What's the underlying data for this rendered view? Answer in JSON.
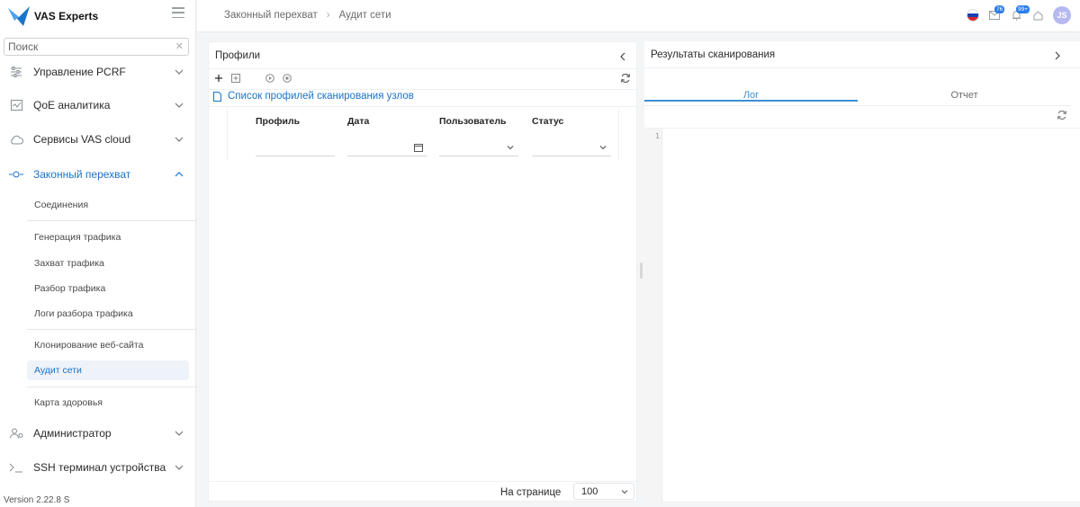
{
  "app": {
    "logo_text": "VAS Experts",
    "version": "Version 2.22.8 S"
  },
  "search": {
    "placeholder": "Поиск",
    "value": ""
  },
  "sidebar": {
    "items": [
      {
        "label": "Управление PCRF",
        "icon": "sliders-icon",
        "expanded": false
      },
      {
        "label": "QoE аналитика",
        "icon": "chart-icon",
        "expanded": false
      },
      {
        "label": "Сервисы VAS cloud",
        "icon": "cloud-icon",
        "expanded": false
      },
      {
        "label": "Законный перехват",
        "icon": "intercept-icon",
        "expanded": true,
        "active": true
      },
      {
        "label": "Администратор",
        "icon": "admin-icon",
        "expanded": false
      },
      {
        "label": "SSH терминал устройства",
        "icon": "terminal-icon",
        "expanded": false
      }
    ],
    "sub_items": [
      "Соединения",
      "Генерация трафика",
      "Захват трафика",
      "Разбор трафика",
      "Логи разбора трафика",
      "Клонирование веб-сайта",
      "Аудит сети",
      "Карта здоровья"
    ],
    "selected_sub_item": "Аудит сети"
  },
  "breadcrumb": {
    "parent": "Законный перехват",
    "current": "Аудит сети"
  },
  "header": {
    "mail_badge": "76",
    "notifications_badge": "99+",
    "avatar_initials": "JS"
  },
  "profiles": {
    "title": "Профили",
    "list_link": "Список профилей сканирования узлов",
    "columns": [
      "Профиль",
      "Дата",
      "Пользователь",
      "Статус"
    ],
    "per_page_label": "На странице",
    "per_page_value": "100"
  },
  "results": {
    "title": "Результаты сканирования",
    "tabs": [
      "Лог",
      "Отчет"
    ],
    "active_tab": "Лог",
    "line_number": "1"
  },
  "colors": {
    "accent": "#1a73c8",
    "tab_accent": "#3d8fd6",
    "avatar": "#b6b9f0",
    "badge": "#2b7de9"
  }
}
